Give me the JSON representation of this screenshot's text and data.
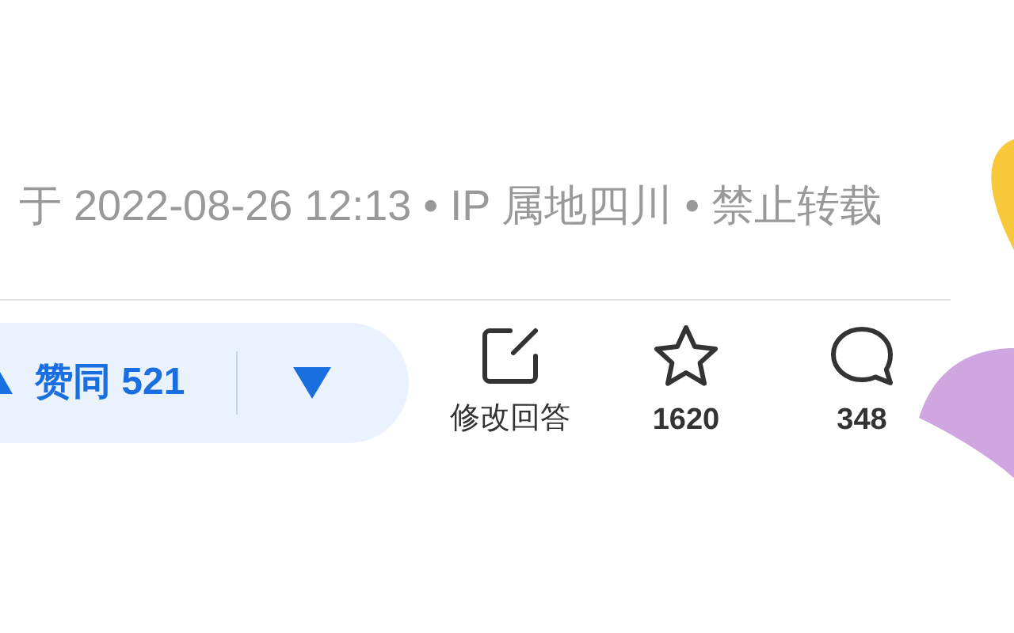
{
  "meta": {
    "text": "于 2022-08-26 12:13 • IP 属地四川 • 禁止转载"
  },
  "vote": {
    "upvote_label": "赞同 521"
  },
  "actions": [
    {
      "kind": "edit",
      "label": "修改回答"
    },
    {
      "kind": "star",
      "label": "1620"
    },
    {
      "kind": "comment",
      "label": "348"
    }
  ]
}
